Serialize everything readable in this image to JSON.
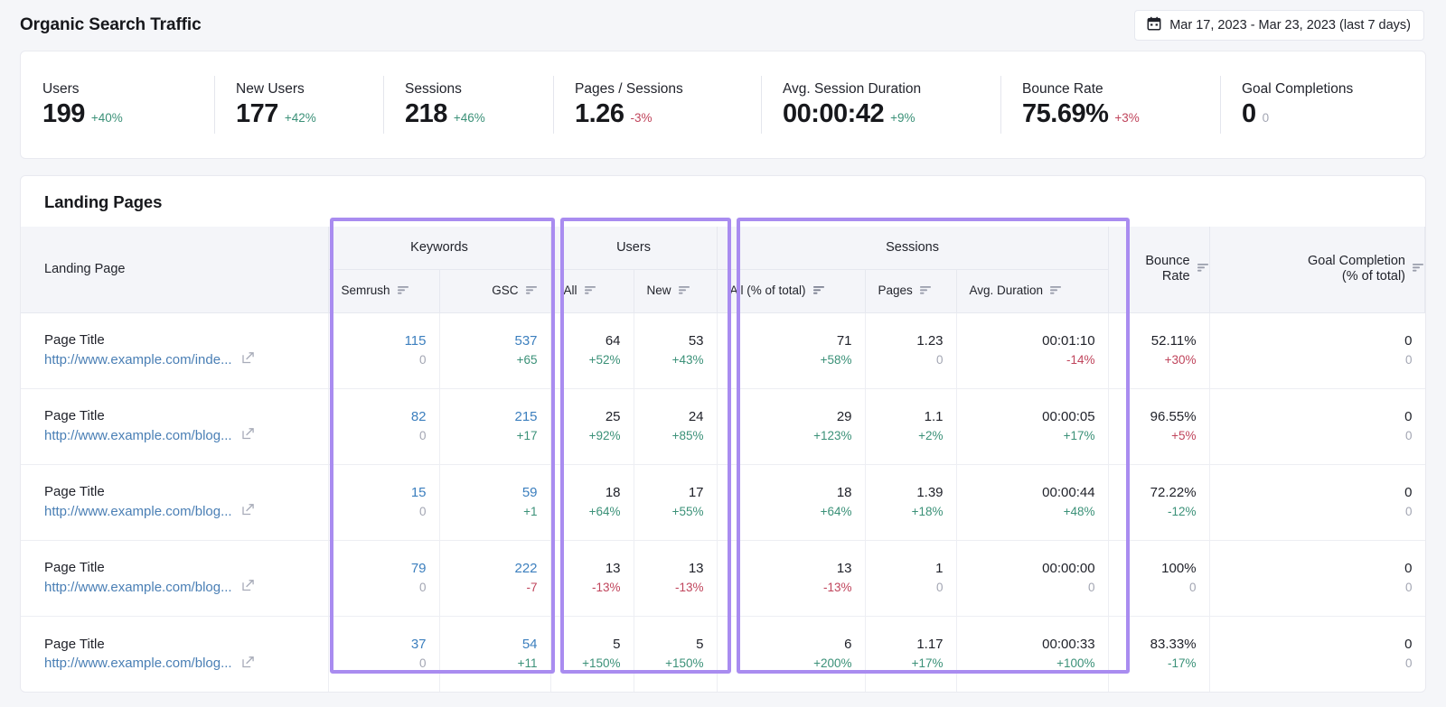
{
  "header": {
    "title": "Organic Search Traffic",
    "date_range": "Mar 17, 2023 - Mar 23, 2023 (last 7 days)",
    "calendar_icon": "calendar-icon"
  },
  "kpis": [
    {
      "label": "Users",
      "value": "199",
      "delta": "+40%",
      "trend": "up"
    },
    {
      "label": "New Users",
      "value": "177",
      "delta": "+42%",
      "trend": "up"
    },
    {
      "label": "Sessions",
      "value": "218",
      "delta": "+46%",
      "trend": "up"
    },
    {
      "label": "Pages / Sessions",
      "value": "1.26",
      "delta": "-3%",
      "trend": "down"
    },
    {
      "label": "Avg. Session Duration",
      "value": "00:00:42",
      "delta": "+9%",
      "trend": "up"
    },
    {
      "label": "Bounce Rate",
      "value": "75.69%",
      "delta": "+3%",
      "trend": "down"
    },
    {
      "label": "Goal Completions",
      "value": "0",
      "delta": "0",
      "trend": "zero"
    }
  ],
  "table": {
    "title": "Landing Pages",
    "first_column_header": "Landing Page",
    "groups": [
      {
        "label": "Keywords"
      },
      {
        "label": "Users"
      },
      {
        "label": "Sessions"
      }
    ],
    "subheaders": {
      "semrush": "Semrush",
      "gsc": "GSC",
      "users_all": "All",
      "users_new": "New",
      "sessions_all": "All (% of total)",
      "sessions_pages": "Pages",
      "sessions_duration": "Avg. Duration",
      "bounce_rate": "Bounce\nRate",
      "goal_completion": "Goal Completion\n(% of total)"
    },
    "sort_icon": "sort-icon",
    "external_link_icon": "external-link-icon",
    "rows": [
      {
        "title": "Page Title",
        "url": "http://www.example.com/inde...",
        "semrush": {
          "value": "115",
          "delta": "0",
          "trend": "zero"
        },
        "gsc": {
          "value": "537",
          "delta": "+65",
          "trend": "up"
        },
        "users_all": {
          "value": "64",
          "delta": "+52%",
          "trend": "up"
        },
        "users_new": {
          "value": "53",
          "delta": "+43%",
          "trend": "up"
        },
        "sess_all": {
          "value": "71",
          "delta": "+58%",
          "trend": "up"
        },
        "sess_pages": {
          "value": "1.23",
          "delta": "0",
          "trend": "zero"
        },
        "sess_dur": {
          "value": "00:01:10",
          "delta": "-14%",
          "trend": "down"
        },
        "bounce": {
          "value": "52.11%",
          "delta": "+30%",
          "trend": "down"
        },
        "goal": {
          "value": "0",
          "delta": "0",
          "trend": "zero"
        }
      },
      {
        "title": "Page Title",
        "url": "http://www.example.com/blog...",
        "semrush": {
          "value": "82",
          "delta": "0",
          "trend": "zero"
        },
        "gsc": {
          "value": "215",
          "delta": "+17",
          "trend": "up"
        },
        "users_all": {
          "value": "25",
          "delta": "+92%",
          "trend": "up"
        },
        "users_new": {
          "value": "24",
          "delta": "+85%",
          "trend": "up"
        },
        "sess_all": {
          "value": "29",
          "delta": "+123%",
          "trend": "up"
        },
        "sess_pages": {
          "value": "1.1",
          "delta": "+2%",
          "trend": "up"
        },
        "sess_dur": {
          "value": "00:00:05",
          "delta": "+17%",
          "trend": "up"
        },
        "bounce": {
          "value": "96.55%",
          "delta": "+5%",
          "trend": "down"
        },
        "goal": {
          "value": "0",
          "delta": "0",
          "trend": "zero"
        }
      },
      {
        "title": "Page Title",
        "url": "http://www.example.com/blog...",
        "semrush": {
          "value": "15",
          "delta": "0",
          "trend": "zero"
        },
        "gsc": {
          "value": "59",
          "delta": "+1",
          "trend": "up"
        },
        "users_all": {
          "value": "18",
          "delta": "+64%",
          "trend": "up"
        },
        "users_new": {
          "value": "17",
          "delta": "+55%",
          "trend": "up"
        },
        "sess_all": {
          "value": "18",
          "delta": "+64%",
          "trend": "up"
        },
        "sess_pages": {
          "value": "1.39",
          "delta": "+18%",
          "trend": "up"
        },
        "sess_dur": {
          "value": "00:00:44",
          "delta": "+48%",
          "trend": "up"
        },
        "bounce": {
          "value": "72.22%",
          "delta": "-12%",
          "trend": "up"
        },
        "goal": {
          "value": "0",
          "delta": "0",
          "trend": "zero"
        }
      },
      {
        "title": "Page Title",
        "url": "http://www.example.com/blog...",
        "semrush": {
          "value": "79",
          "delta": "0",
          "trend": "zero"
        },
        "gsc": {
          "value": "222",
          "delta": "-7",
          "trend": "down"
        },
        "users_all": {
          "value": "13",
          "delta": "-13%",
          "trend": "down"
        },
        "users_new": {
          "value": "13",
          "delta": "-13%",
          "trend": "down"
        },
        "sess_all": {
          "value": "13",
          "delta": "-13%",
          "trend": "down"
        },
        "sess_pages": {
          "value": "1",
          "delta": "0",
          "trend": "zero"
        },
        "sess_dur": {
          "value": "00:00:00",
          "delta": "0",
          "trend": "zero"
        },
        "bounce": {
          "value": "100%",
          "delta": "0",
          "trend": "zero"
        },
        "goal": {
          "value": "0",
          "delta": "0",
          "trend": "zero"
        }
      },
      {
        "title": "Page Title",
        "url": "http://www.example.com/blog...",
        "semrush": {
          "value": "37",
          "delta": "0",
          "trend": "zero"
        },
        "gsc": {
          "value": "54",
          "delta": "+11",
          "trend": "up"
        },
        "users_all": {
          "value": "5",
          "delta": "+150%",
          "trend": "up"
        },
        "users_new": {
          "value": "5",
          "delta": "+150%",
          "trend": "up"
        },
        "sess_all": {
          "value": "6",
          "delta": "+200%",
          "trend": "up"
        },
        "sess_pages": {
          "value": "1.17",
          "delta": "+17%",
          "trend": "up"
        },
        "sess_dur": {
          "value": "00:00:33",
          "delta": "+100%",
          "trend": "up"
        },
        "bounce": {
          "value": "83.33%",
          "delta": "-17%",
          "trend": "up"
        },
        "goal": {
          "value": "0",
          "delta": "0",
          "trend": "zero"
        }
      }
    ]
  },
  "colors": {
    "highlight": "#a98cf0",
    "positive": "#3b9178",
    "negative": "#c0455c",
    "link": "#4a7fb5",
    "keyword_number": "#3c7fbe"
  }
}
